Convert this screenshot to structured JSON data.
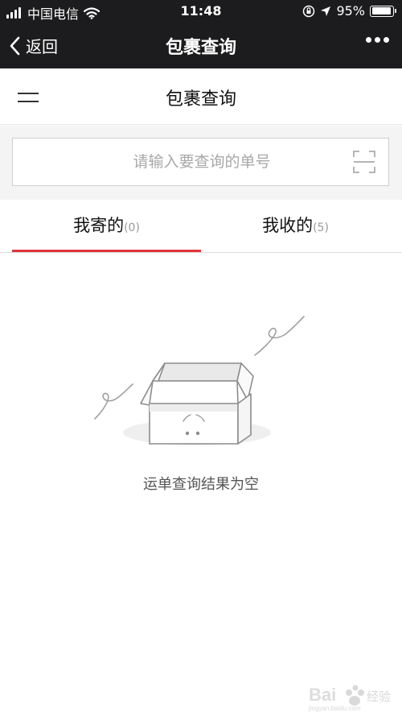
{
  "status_bar": {
    "carrier": "中国电信",
    "time": "11:48",
    "battery": "95%",
    "battery_level": 0.95
  },
  "nav": {
    "back_label": "返回",
    "title": "包裹查询"
  },
  "sub_header": {
    "title": "包裹查询"
  },
  "search": {
    "placeholder": "请输入要查询的单号"
  },
  "tabs": [
    {
      "label": "我寄的",
      "count": "(0)",
      "active": true
    },
    {
      "label": "我收的",
      "count": "(5)",
      "active": false
    }
  ],
  "empty_state": {
    "message": "运单查询结果为空"
  },
  "colors": {
    "accent": "#e0343c",
    "nav_bg": "#1c1c1e"
  },
  "icons": [
    "wifi-icon",
    "chevron-left-icon",
    "more-icon",
    "menu-icon",
    "scan-icon",
    "empty-box-icon"
  ]
}
